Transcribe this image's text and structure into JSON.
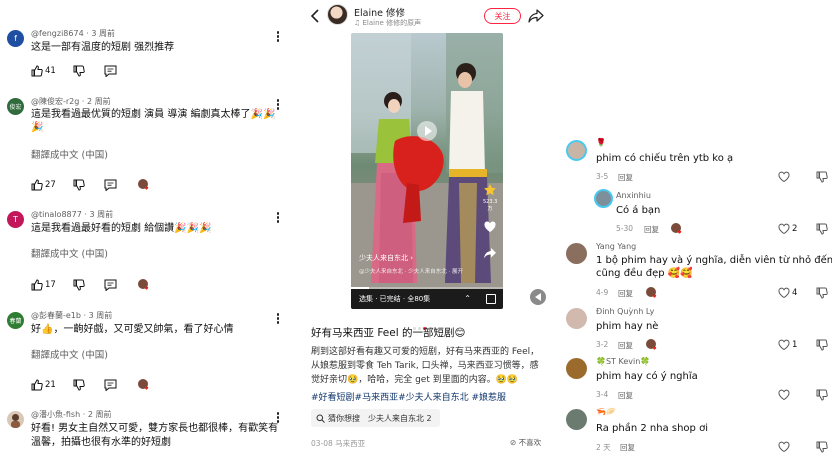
{
  "left_comments": [
    {
      "avatar_letter": "f",
      "avatar_color": "#1f4fa3",
      "author": "@fengzi8674",
      "time": "3 周前",
      "lines": [
        "这是一部有温度的短剧 强烈推荐"
      ],
      "translate": "",
      "likes": "41"
    },
    {
      "avatar_letter": "俊宏",
      "avatar_color": "#2f6b3b",
      "author": "@陳俊宏-r2g",
      "time": "2 周前",
      "lines": [
        "這是我看過最优質的短劇 演員 導演 編劇真太棒了🎉🎉",
        "🎉"
      ],
      "translate": "翻譯成中文 (中国)",
      "likes": "27"
    },
    {
      "avatar_letter": "T",
      "avatar_color": "#c2185b",
      "author": "@tinalo8877",
      "time": "3 周前",
      "lines": [
        "這是我看過最好看的短劇 給個讚🎉🎉🎉"
      ],
      "translate": "翻譯成中文 (中国)",
      "likes": "17"
    },
    {
      "avatar_letter": "春蘭",
      "avatar_color": "#2e7d32",
      "author": "@彭春蘭-e1b",
      "time": "3 周前",
      "lines": [
        "好👍，一齣好戲，又可愛又帥氣，看了好心情"
      ],
      "translate": "翻譯成中文 (中国)",
      "likes": "21"
    },
    {
      "avatar_letter": "",
      "avatar_color": "#d9c7b8",
      "author": "@潘小魚-fish",
      "time": "2 周前",
      "lines": [
        "好看! 男女主自然又可愛，雙方家長也都很棒，有歡笑有",
        "溫馨，拍攝也很有水準的好短劇"
      ],
      "translate": "",
      "likes": ""
    }
  ],
  "xhs": {
    "author": "Elaine 修修",
    "music": "♫ Elaine 修修的原声",
    "follow_label": "关注",
    "video_tag": "少夫人来自东北 ›",
    "video_desc": "@少夫人来自东北 · 少夫人来自东北 · 展开",
    "series_label": "选集 · 已完结 · 全80集",
    "side_count": "523.3万",
    "progress": 0.12,
    "title": "好有马来西亚 Feel 的一部短剧😊",
    "body": [
      "刷到这部好看有趣又可爱的短剧，好有马来西亚的 Feel，",
      "从娘惹服到零食 Teh Tarik, 口头禅，马来西亚习惯等，感",
      "觉好亲切🥹，哈哈，完全 get 到里面的内容。🥹🥹"
    ],
    "tags": "#好看短剧#马来西亚#少夫人来自东北 #娘惹服",
    "search_label": "猜你想搜",
    "search_keyword": "少夫人来自东北 2",
    "date": "03-08 马来西亚",
    "dislike_label": "不喜欢"
  },
  "right_comments": [
    {
      "name": "🌹",
      "text": "phim có chiếu trên ytb ko ạ",
      "time": "3-5",
      "reply": "回复",
      "likes": "",
      "highlight": true,
      "avatar_color": "#c9b5a6"
    },
    {
      "name": "Anxinhiu",
      "text": "Có á bạn",
      "time": "5-30",
      "reply": "回复",
      "likes": "2",
      "highlight": true,
      "avatar_color": "#7e8f9c"
    },
    {
      "name": "Yang Yang",
      "text": [
        "1 bộ phim hay và ý nghĩa, diễn viên từ nhỏ đến lớn",
        "cũng đều đẹp 🥰🥰"
      ],
      "time": "4-9",
      "reply": "回复",
      "likes": "4",
      "highlight": false,
      "avatar_color": "#8b6f5e"
    },
    {
      "name": "Đinh Quỳnh Ly",
      "text": "phim hay nè",
      "time": "3-2",
      "reply": "回复",
      "likes": "1",
      "highlight": false,
      "avatar_color": "#d2b9ad"
    },
    {
      "name": "🍀ST Kevin🍀",
      "text": "phim hay có ý nghĩa",
      "time": "3-4",
      "reply": "回复",
      "likes": "",
      "highlight": false,
      "avatar_color": "#9a6b2c"
    },
    {
      "name": "🦐🥟",
      "text": "Ra phần 2 nha shop ơi",
      "time": "2 天",
      "reply": "回复",
      "likes": "",
      "highlight": false,
      "avatar_color": "#6b7b70"
    }
  ]
}
